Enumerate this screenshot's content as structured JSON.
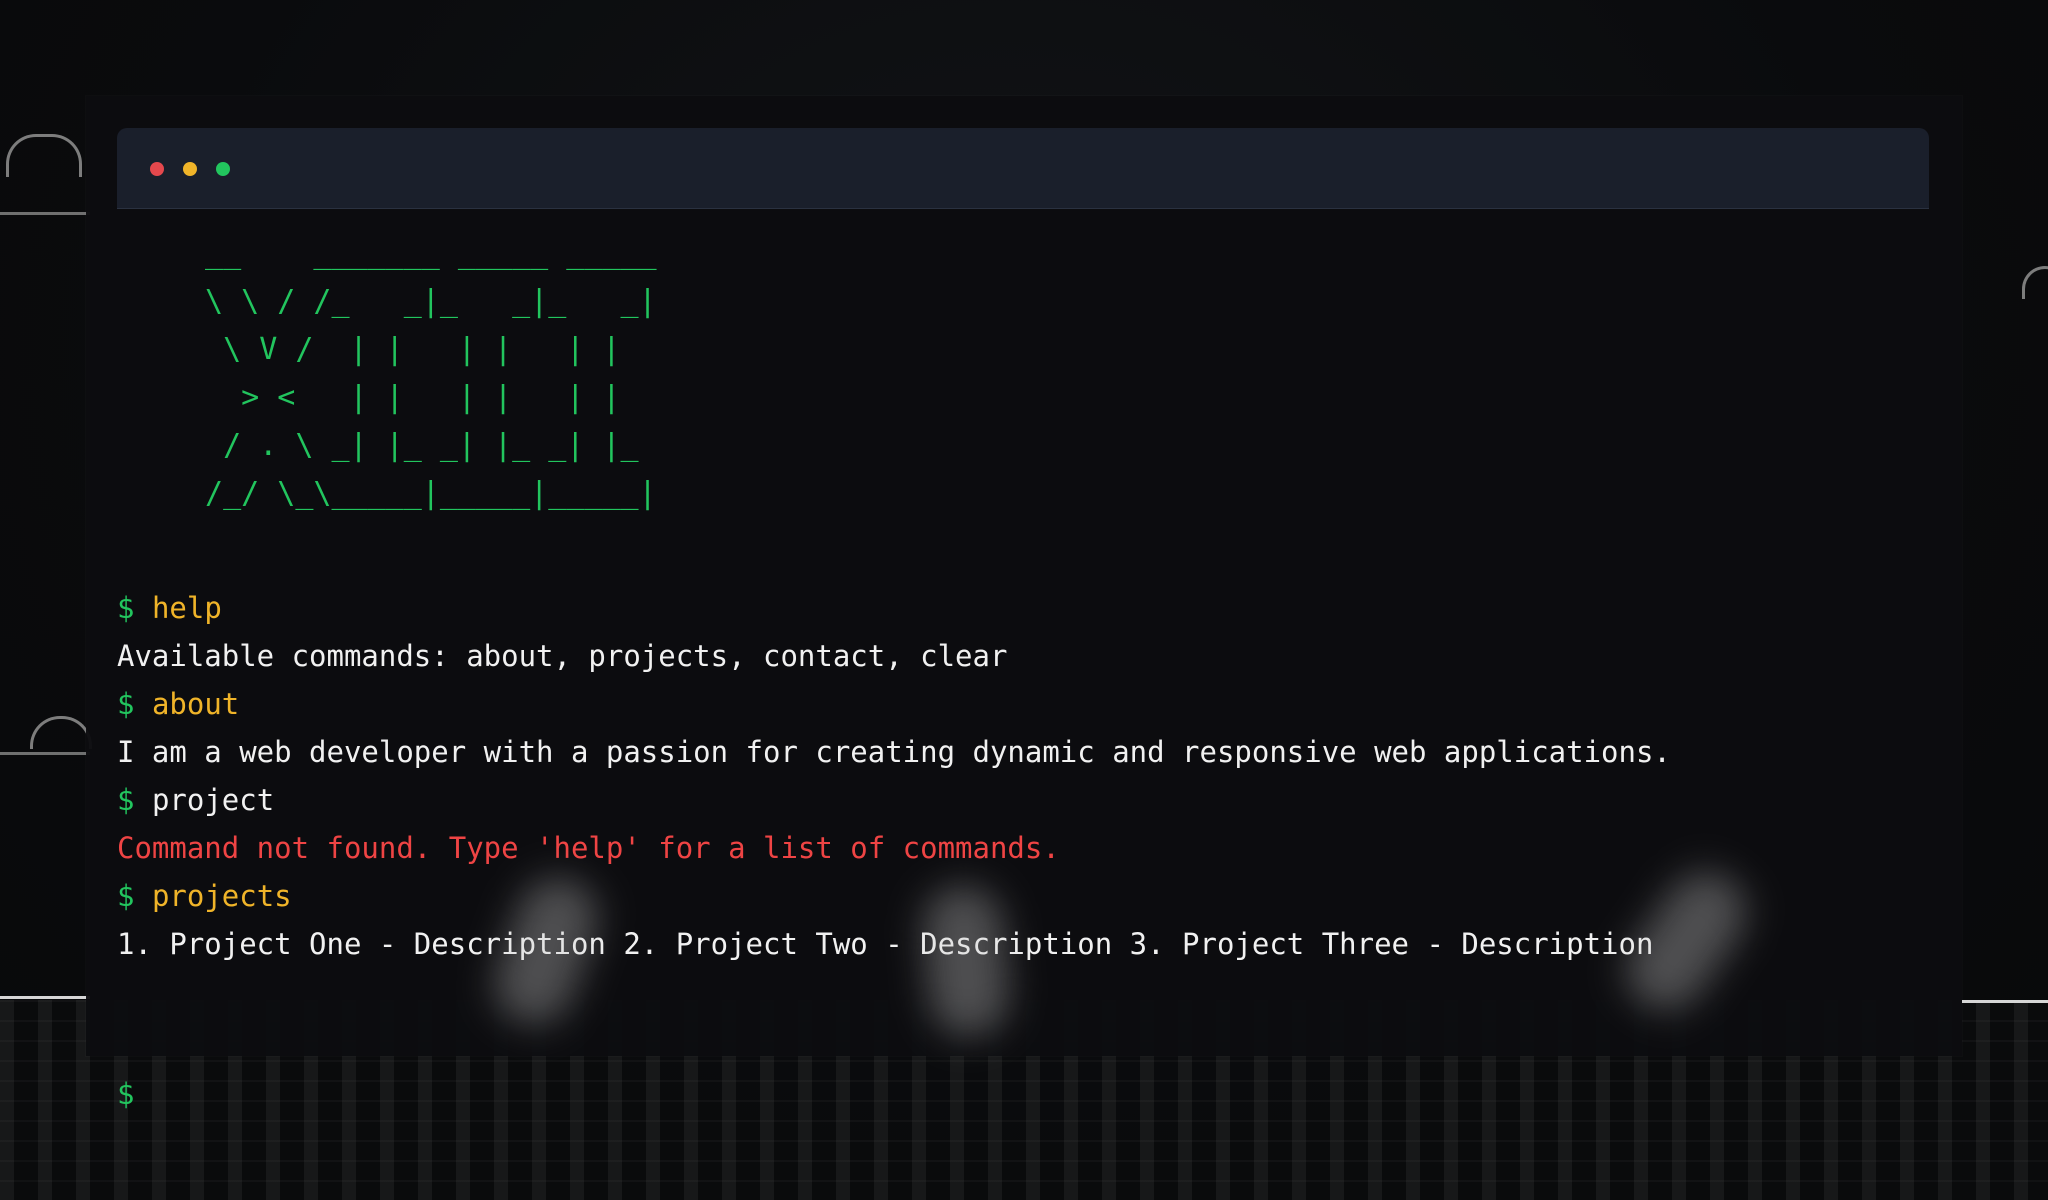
{
  "window": {
    "buttons": [
      {
        "name": "close",
        "color": "#e5484d"
      },
      {
        "name": "minimize",
        "color": "#f0b429"
      },
      {
        "name": "maximize",
        "color": "#22c55e"
      }
    ]
  },
  "banner": {
    "ascii_art": " __    _______ _____ _____\n \\ \\ / /_   _|_   _|_   _|\n  \\ V /  | |   | |   | |\n   > <   | |   | |   | |\n  / . \\ _| |_ _| |_ _| |_\n /_/ \\_\\_____|_____|_____|",
    "color": "#22c55e"
  },
  "history": [
    {
      "type": "command",
      "prompt": "$",
      "text": "help",
      "known": true
    },
    {
      "type": "output",
      "text": "Available commands: about, projects, contact, clear"
    },
    {
      "type": "command",
      "prompt": "$",
      "text": "about",
      "known": true
    },
    {
      "type": "output",
      "text": "I am a web developer with a passion for creating dynamic and responsive web applications."
    },
    {
      "type": "command",
      "prompt": "$",
      "text": "project",
      "known": false
    },
    {
      "type": "error",
      "text": "Command not found. Type 'help' for a list of commands."
    },
    {
      "type": "command",
      "prompt": "$",
      "text": "projects",
      "known": true
    },
    {
      "type": "output",
      "text": "1. Project One - Description 2. Project Two - Description 3. Project Three - Description"
    }
  ],
  "input": {
    "prompt": "$",
    "value": ""
  },
  "colors": {
    "prompt": "#22c55e",
    "known_command": "#f0b429",
    "error": "#ef4444",
    "text": "#f1f1f1",
    "titlebar": "#1a1f2b"
  }
}
